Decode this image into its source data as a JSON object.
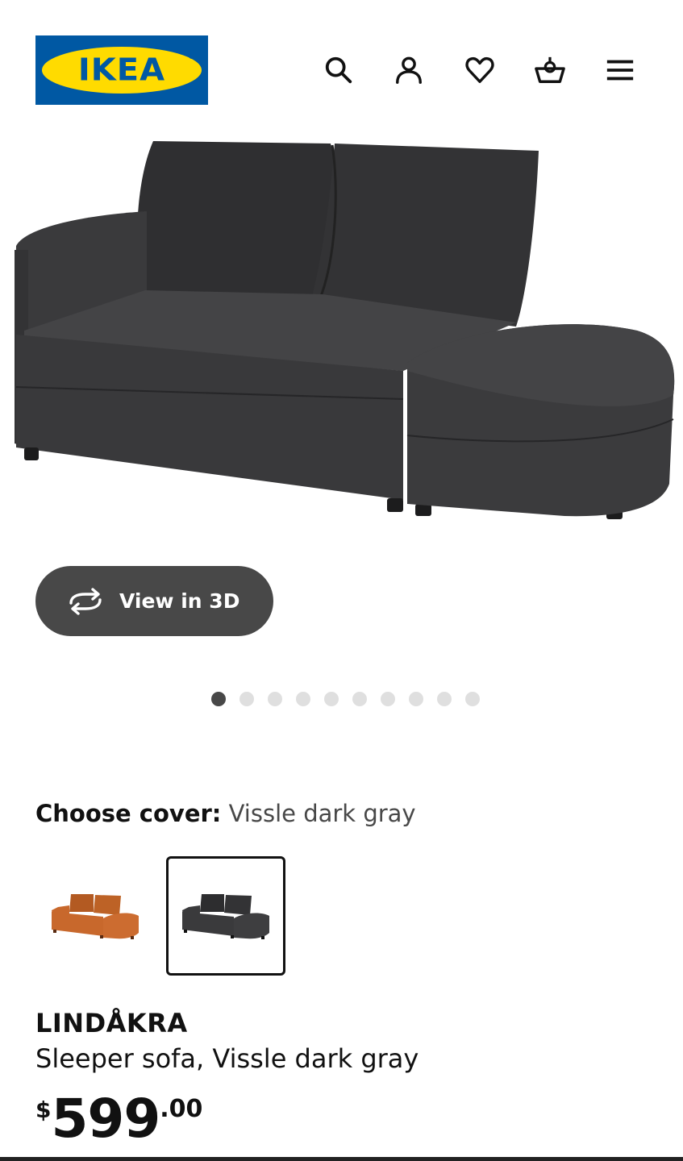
{
  "header": {
    "logo_text": "IKEA",
    "logo_registered": "®",
    "icons": [
      "search-icon",
      "account-icon",
      "favorites-heart-icon",
      "shopping-basket-icon",
      "menu-icon"
    ]
  },
  "gallery": {
    "view_3d_label": "View in 3D",
    "dot_count": 10,
    "active_dot_index": 0
  },
  "cover": {
    "label": "Choose cover:",
    "value": "Vissle dark gray",
    "options": [
      {
        "color": "#c8682c",
        "selected": false
      },
      {
        "color": "#3a3a3c",
        "selected": true
      }
    ]
  },
  "product": {
    "name": "LINDÅKRA",
    "description": "Sleeper sofa, Vissle dark gray",
    "price": {
      "currency": "$",
      "integer": "599",
      "decimal": ".00"
    }
  },
  "colors": {
    "brand_blue": "#0058a3",
    "brand_yellow": "#ffdb00",
    "button_dark": "#484848",
    "sofa_fabric": "#3a3a3c"
  }
}
